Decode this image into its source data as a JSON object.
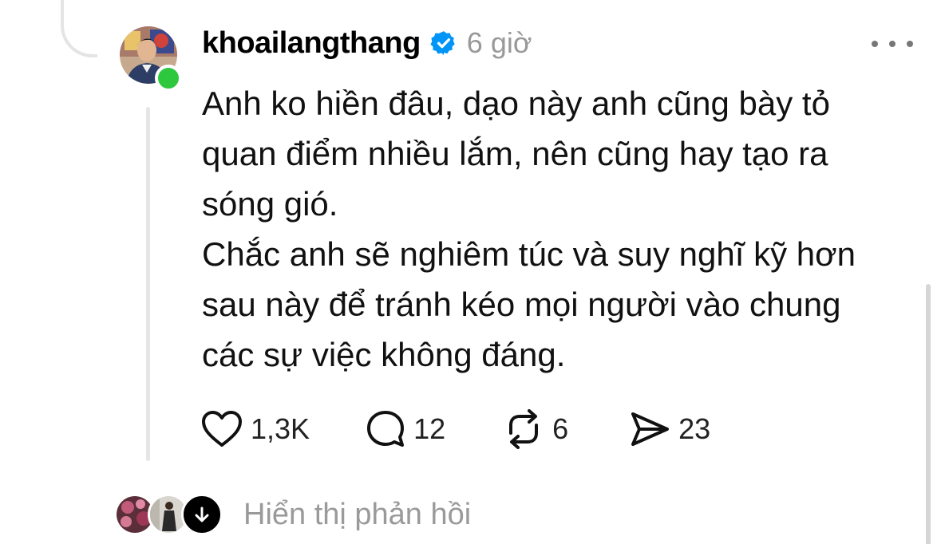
{
  "post": {
    "username": "khoailangthang",
    "timestamp": "6 giờ",
    "paragraphs": [
      "Anh ko hiền đâu, dạo này anh cũng bày tỏ\nquan điểm nhiều lắm, nên cũng hay tạo ra\nsóng gió.",
      "Chắc anh sẽ nghiêm túc và suy nghĩ kỹ hơn\nsau này để tránh kéo mọi người vào chung\ncác sự việc không đáng."
    ],
    "stats": {
      "likes": "1,3K",
      "replies": "12",
      "reposts": "6",
      "shares": "23"
    }
  },
  "replies_link": {
    "label": "Hiển thị phản hồi"
  },
  "icons": {
    "verified": "verified-badge-icon",
    "more": "more-options-icon",
    "like": "heart-icon",
    "reply": "comment-bubble-icon",
    "repost": "repost-icon",
    "share": "send-icon",
    "expand": "arrow-down-icon"
  },
  "colors": {
    "verified_blue": "#0095f6",
    "online_green": "#2dc83e",
    "muted_text": "#999999"
  }
}
